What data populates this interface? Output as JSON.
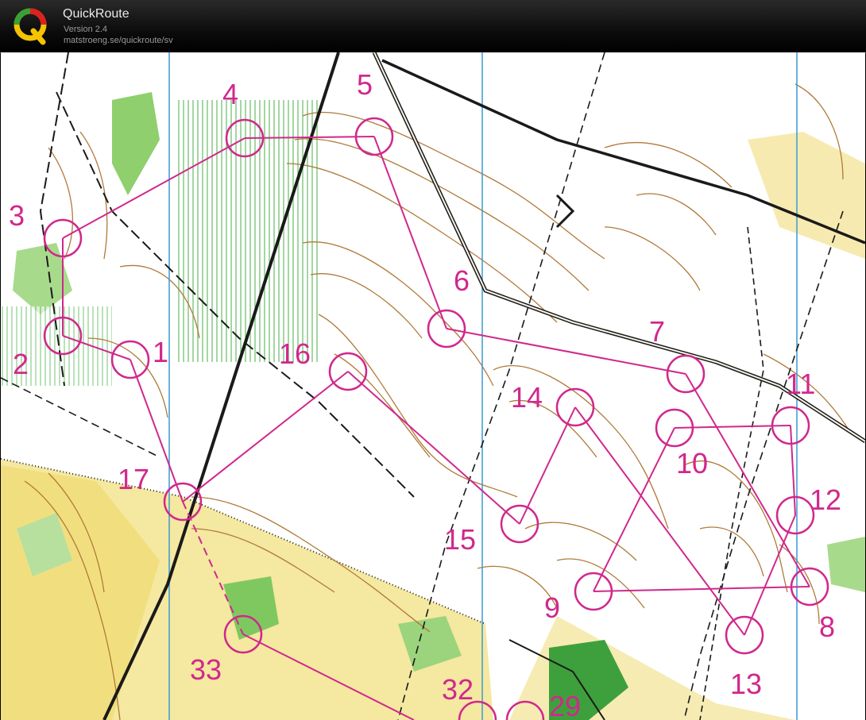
{
  "app": {
    "title": "QuickRoute",
    "version": "Version 2.4",
    "url": "matstroeng.se/quickroute/sv"
  },
  "colors": {
    "course": "#d0288c",
    "contour": "#b07a3a",
    "vegetation_light": "#cde8b4",
    "vegetation_dark": "#4fae4a",
    "open_land": "#f3e58a",
    "magnetic_north": "#3a9ad0",
    "track": "#1a1a1a"
  },
  "map": {
    "controls": [
      {
        "label": "1"
      },
      {
        "label": "2"
      },
      {
        "label": "3"
      },
      {
        "label": "4"
      },
      {
        "label": "5"
      },
      {
        "label": "6"
      },
      {
        "label": "7"
      },
      {
        "label": "8"
      },
      {
        "label": "9"
      },
      {
        "label": "10"
      },
      {
        "label": "11"
      },
      {
        "label": "12"
      },
      {
        "label": "13"
      },
      {
        "label": "14"
      },
      {
        "label": "15"
      },
      {
        "label": "16"
      },
      {
        "label": "17"
      },
      {
        "label": "29"
      },
      {
        "label": "32"
      },
      {
        "label": "33"
      }
    ]
  }
}
